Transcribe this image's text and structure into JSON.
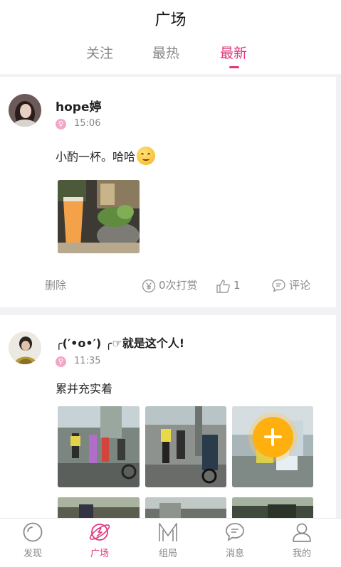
{
  "header": {
    "title": "广场",
    "tabs": [
      {
        "label": "关注",
        "active": false
      },
      {
        "label": "最热",
        "active": false
      },
      {
        "label": "最新",
        "active": true
      }
    ]
  },
  "posts": [
    {
      "username": "hope婷",
      "time": "15:06",
      "text": "小酌一杯。哈哈",
      "emoji": "smiling-face",
      "delete_label": "删除",
      "reward_label": "0次打赏",
      "likes": "1",
      "comment_label": "评论"
    },
    {
      "username": "╭(′•o•′) ╭☞就是这个人!",
      "time": "11:35",
      "text": "累并充实着"
    }
  ],
  "fab_icon": "plus-icon",
  "bottom_nav": {
    "items": [
      {
        "label": "发现",
        "icon": "discover-icon",
        "active": false
      },
      {
        "label": "广场",
        "icon": "plaza-icon",
        "active": true
      },
      {
        "label": "组局",
        "icon": "group-icon",
        "active": false
      },
      {
        "label": "消息",
        "icon": "message-icon",
        "active": false
      },
      {
        "label": "我的",
        "icon": "profile-icon",
        "active": false
      }
    ]
  },
  "colors": {
    "accent": "#e2357b",
    "fab": "#ffb00f",
    "muted": "#888888"
  }
}
